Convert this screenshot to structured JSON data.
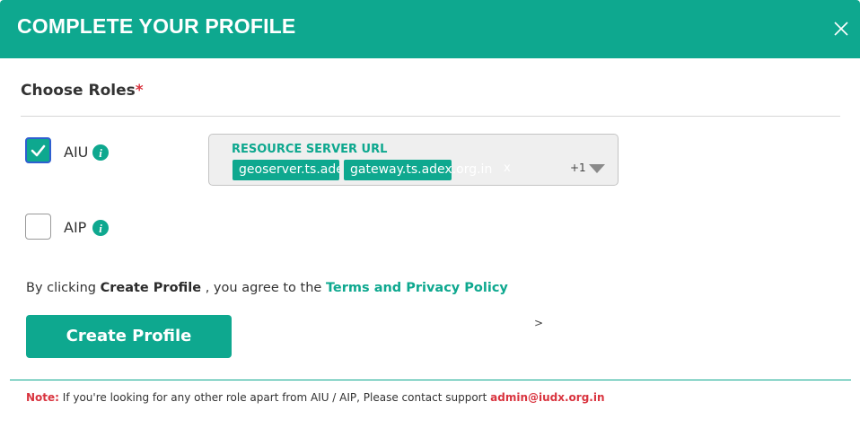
{
  "header": {
    "title": "COMPLETE YOUR PROFILE",
    "close_icon": "close-icon"
  },
  "roles": {
    "title": "Choose Roles",
    "required_mark": "*",
    "items": [
      {
        "label": "AIU",
        "checked": true,
        "info_icon": "info-icon"
      },
      {
        "label": "AIP",
        "checked": false,
        "info_icon": "info-icon"
      }
    ]
  },
  "resource_server": {
    "label": "RESOURCE SERVER URL",
    "chips": [
      "geoserver.ts.adex.org.in",
      "gateway.ts.adex.org.in"
    ],
    "chip_remove": "x",
    "more_count": "+1"
  },
  "agreement": {
    "prefix": "By clicking ",
    "action": "Create Profile",
    "middle": " , you agree to the ",
    "link": "Terms and Privacy Policy"
  },
  "create_button": {
    "label": "Create Profile"
  },
  "stray_chevron": ">",
  "note": {
    "label": "Note:",
    "text": " If you're looking for any other role apart from AIU / AIP, Please contact support ",
    "email": "admin@iudx.org.in"
  },
  "colors": {
    "primary": "#0ea88f",
    "required": "#d9343f",
    "focus": "#2f5fd0"
  }
}
